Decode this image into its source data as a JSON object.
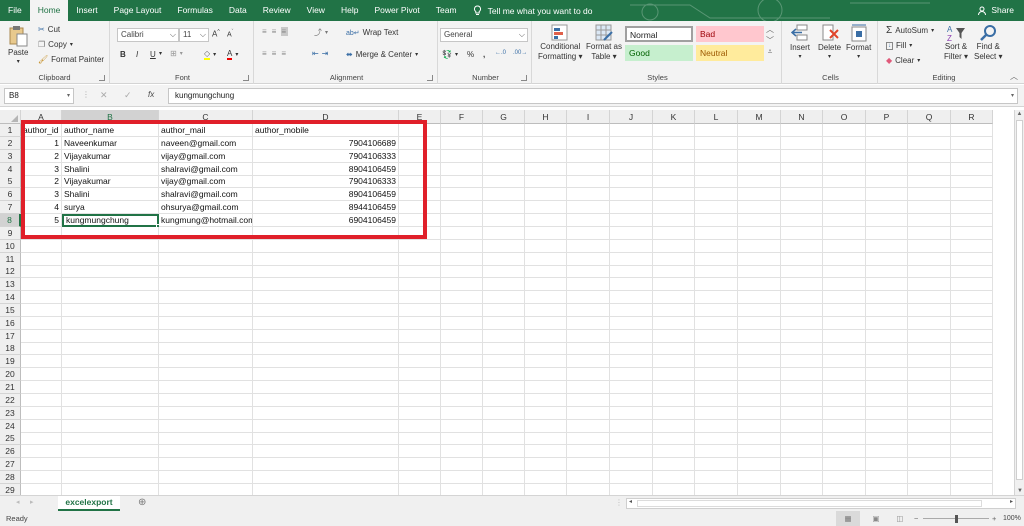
{
  "menu": {
    "tabs": [
      "File",
      "Home",
      "Insert",
      "Page Layout",
      "Formulas",
      "Data",
      "Review",
      "View",
      "Help",
      "Power Pivot",
      "Team"
    ],
    "active_tab": "Home",
    "tell_me": "Tell me what you want to do",
    "share": "Share"
  },
  "ribbon": {
    "clipboard": {
      "label": "Clipboard",
      "paste": "Paste",
      "cut": "Cut",
      "copy": "Copy",
      "format_painter": "Format Painter"
    },
    "font": {
      "label": "Font",
      "name": "Calibri",
      "size": "11",
      "bold": "B",
      "italic": "I",
      "underline": "U"
    },
    "alignment": {
      "label": "Alignment",
      "wrap_text": "Wrap Text",
      "merge_center": "Merge & Center"
    },
    "number": {
      "label": "Number",
      "format": "General",
      "percent": "%",
      "comma": ","
    },
    "styles": {
      "label": "Styles",
      "conditional_formatting_1": "Conditional",
      "conditional_formatting_2": "Formatting",
      "format_table_1": "Format as",
      "format_table_2": "Table",
      "normal": "Normal",
      "bad": "Bad",
      "good": "Good",
      "neutral": "Neutral"
    },
    "cells": {
      "label": "Cells",
      "insert": "Insert",
      "delete": "Delete",
      "format": "Format"
    },
    "editing": {
      "label": "Editing",
      "autosum": "AutoSum",
      "fill": "Fill",
      "clear": "Clear",
      "sort_filter_1": "Sort &",
      "sort_filter_2": "Filter",
      "find_select_1": "Find &",
      "find_select_2": "Select"
    }
  },
  "formula_bar": {
    "name_box": "B8",
    "fx": "fx",
    "value": "kungmungchung"
  },
  "sheet": {
    "columns": [
      "A",
      "B",
      "C",
      "D",
      "E",
      "F",
      "G",
      "H",
      "I",
      "J",
      "K",
      "L",
      "M",
      "N",
      "O",
      "P",
      "Q",
      "R"
    ],
    "selected_column": "B",
    "selected_row": 8,
    "active_cell": "B8",
    "header_row": [
      "author_id",
      "author_name",
      "author_mail",
      "author_mobile"
    ],
    "rows": [
      [
        "1",
        "Naveenkumar",
        "naveen@gmail.com",
        "7904106689"
      ],
      [
        "2",
        "Vijayakumar",
        "vijay@gmail.com",
        "7904106333"
      ],
      [
        "3",
        "Shalini",
        "shalravi@gmail.com",
        "8904106459"
      ],
      [
        "2",
        "Vijayakumar",
        "vijay@gmail.com",
        "7904106333"
      ],
      [
        "3",
        "Shalini",
        "shalravi@gmail.com",
        "8904106459"
      ],
      [
        "4",
        "surya",
        "ohsurya@gmail.com",
        "8944106459"
      ],
      [
        "5",
        "kungmungchung",
        "kungmung@hotmail.com",
        "6904106459"
      ]
    ],
    "visible_row_count": 29,
    "highlight_color": "#e0202a"
  },
  "sheet_tabs": {
    "tabs": [
      "excelexport"
    ],
    "active": "excelexport"
  },
  "status_bar": {
    "status": "Ready",
    "zoom": "100%",
    "zoom_level_pct": 100
  },
  "colors": {
    "brand": "#217346",
    "bad_bg": "#ffc7ce",
    "bad_fg": "#9c0006",
    "good_bg": "#c6efce",
    "good_fg": "#006100",
    "neutral_bg": "#ffeb9c",
    "neutral_fg": "#9c5700"
  }
}
